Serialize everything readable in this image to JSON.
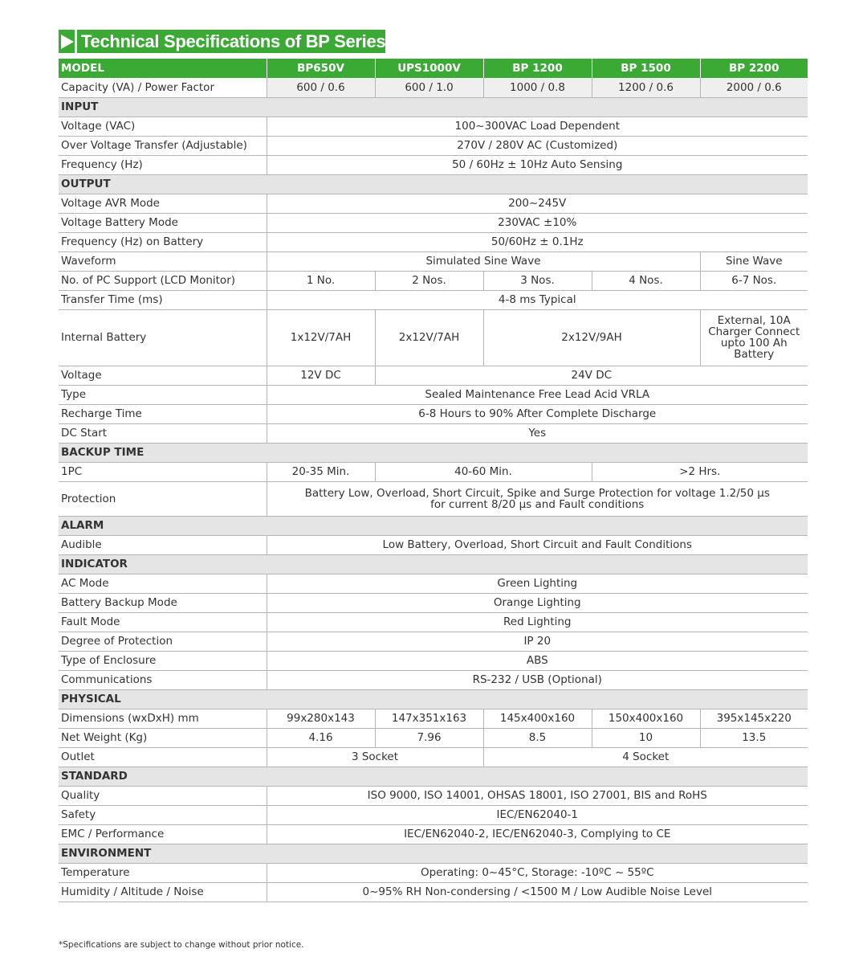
{
  "title": "Technical Specifications of BP Series",
  "header": {
    "label": "MODEL",
    "models": [
      "BP650V",
      "UPS1000V",
      "BP 1200",
      "BP 1500",
      "BP 2200"
    ]
  },
  "sections": {
    "input": "INPUT",
    "output": "OUTPUT",
    "backup": "BACKUP TIME",
    "alarm": "ALARM",
    "indicator": "INDICATOR",
    "physical": "PHYSICAL",
    "standard": "STANDARD",
    "environment": "ENVIRONMENT"
  },
  "rows": {
    "capacity": {
      "label": "Capacity (VA) / Power Factor",
      "values": [
        "600 / 0.6",
        "600 / 1.0",
        "1000 / 0.8",
        "1200 / 0.6",
        "2000 / 0.6"
      ]
    },
    "in_voltage": {
      "label": "Voltage (VAC)",
      "value": "100~300VAC Load Dependent"
    },
    "over_voltage": {
      "label": "Over Voltage Transfer (Adjustable)",
      "value": "270V / 280V AC (Customized)"
    },
    "in_frequency": {
      "label": "Frequency (Hz)",
      "value": "50 / 60Hz ± 10Hz Auto Sensing"
    },
    "avr_voltage": {
      "label": "Voltage AVR Mode",
      "value": "200~245V"
    },
    "battery_voltage_mode": {
      "label": "Voltage Battery Mode",
      "value": "230VAC ±10%"
    },
    "freq_battery": {
      "label": "Frequency (Hz) on Battery",
      "value": "50/60Hz ± 0.1Hz"
    },
    "waveform": {
      "label": "Waveform",
      "value_a": "Simulated Sine Wave",
      "value_b": "Sine Wave"
    },
    "pc_support": {
      "label": "No. of PC Support (LCD Monitor)",
      "values": [
        "1 No.",
        "2 Nos.",
        "3 Nos.",
        "4 Nos.",
        "6-7 Nos."
      ]
    },
    "transfer_time": {
      "label": "Transfer Time (ms)",
      "value": "4-8 ms Typical"
    },
    "internal_battery": {
      "label": "Internal Battery",
      "value_a": "1x12V/7AH",
      "value_b": "2x12V/7AH",
      "value_c": "2x12V/9AH",
      "value_d": "External, 10A Charger Connect upto 100 Ah Battery"
    },
    "dc_voltage": {
      "label": "Voltage",
      "value_a": "12V DC",
      "value_b": "24V DC"
    },
    "type": {
      "label": "Type",
      "value": "Sealed Maintenance Free Lead Acid VRLA"
    },
    "recharge": {
      "label": "Recharge Time",
      "value": "6-8 Hours to 90% After Complete Discharge"
    },
    "dc_start": {
      "label": "DC Start",
      "value": "Yes"
    },
    "one_pc": {
      "label": "1PC",
      "value_a": "20-35 Min.",
      "value_b": "40-60 Min.",
      "value_c": ">2 Hrs."
    },
    "protection": {
      "label": "Protection",
      "value_line1": "Battery Low, Overload, Short Circuit, Spike and Surge Protection for voltage 1.2/50 μs",
      "value_line2": "for current 8/20 μs and Fault conditions"
    },
    "audible": {
      "label": "Audible",
      "value": "Low Battery, Overload, Short Circuit and Fault Conditions"
    },
    "ac_mode": {
      "label": "AC Mode",
      "value": "Green Lighting"
    },
    "battery_backup_mode": {
      "label": "Battery Backup Mode",
      "value": "Orange Lighting"
    },
    "fault_mode": {
      "label": "Fault Mode",
      "value": "Red Lighting"
    },
    "degree_protection": {
      "label": "Degree of Protection",
      "value": "IP 20"
    },
    "enclosure": {
      "label": "Type of Enclosure",
      "value": "ABS"
    },
    "communications": {
      "label": "Communications",
      "value": "RS-232 / USB (Optional)"
    },
    "dimensions": {
      "label": "Dimensions (wxDxH) mm",
      "values": [
        "99x280x143",
        "147x351x163",
        "145x400x160",
        "150x400x160",
        "395x145x220"
      ]
    },
    "net_weight": {
      "label": "Net Weight (Kg)",
      "values": [
        "4.16",
        "7.96",
        "8.5",
        "10",
        "13.5"
      ]
    },
    "outlet": {
      "label": "Outlet",
      "value_a": "3 Socket",
      "value_b": "4 Socket"
    },
    "quality": {
      "label": "Quality",
      "value": "ISO 9000, ISO 14001, OHSAS 18001, ISO 27001, BIS and RoHS"
    },
    "safety": {
      "label": "Safety",
      "value": "IEC/EN62040-1"
    },
    "emc": {
      "label": "EMC / Performance",
      "value": "IEC/EN62040-2, IEC/EN62040-3, Complying to CE"
    },
    "temperature": {
      "label": "Temperature",
      "value": "Operating: 0~45°C, Storage: -10ºC ~ 55ºC"
    },
    "humidity": {
      "label": "Humidity / Altitude / Noise",
      "value": "0~95% RH Non-condersing / <1500 M / Low Audible Noise Level"
    }
  },
  "footnote": "*Specifications are subject to change without prior notice.",
  "colors": {
    "accent": "#3aaa35",
    "section_bg": "#e5e5e5",
    "rule": "#b5b5b5"
  },
  "icons": {
    "title": "play-arrow-icon"
  }
}
